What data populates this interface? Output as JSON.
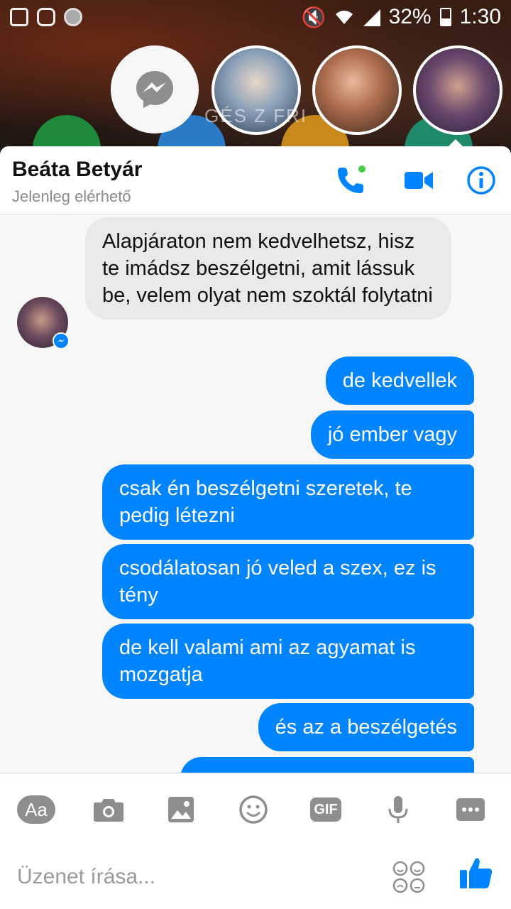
{
  "status_bar": {
    "battery": "32%",
    "time": "1:30"
  },
  "chat_heads": {
    "overlay_text": "GÉS   Z  FRI"
  },
  "header": {
    "contact_name": "Beáta Betyár",
    "status": "Jelenleg elérhető"
  },
  "messages": [
    {
      "from": "other",
      "text": "Alapjáraton nem kedvelhetsz, hisz te imádsz beszélgetni, amit lássuk be, velem olyat nem szoktál folytatni"
    },
    {
      "from": "me",
      "text": "de kedvellek"
    },
    {
      "from": "me",
      "text": "jó ember vagy"
    },
    {
      "from": "me",
      "text": "csak én beszélgetni szeretek, te pedig létezni"
    },
    {
      "from": "me",
      "text": "csodálatosan jó veled a szex, ez is tény"
    },
    {
      "from": "me",
      "text": "de kell valami ami az agyamat is mozgatja"
    },
    {
      "from": "me",
      "text": "és az a beszélgetés"
    },
    {
      "from": "me",
      "text": ""
    }
  ],
  "composer": {
    "aa_label": "Aa",
    "gif_label": "GIF",
    "placeholder": "Üzenet írása..."
  },
  "icons": [
    "messenger-icon",
    "phone-icon",
    "video-icon",
    "info-icon",
    "camera-icon",
    "image-icon",
    "emoji-icon",
    "microphone-icon",
    "more-icon",
    "stickers-icon",
    "like-icon"
  ],
  "colors": {
    "accent": "#0084ff",
    "incoming_bubble": "#e9e9e9",
    "online_dot": "#44d244"
  }
}
